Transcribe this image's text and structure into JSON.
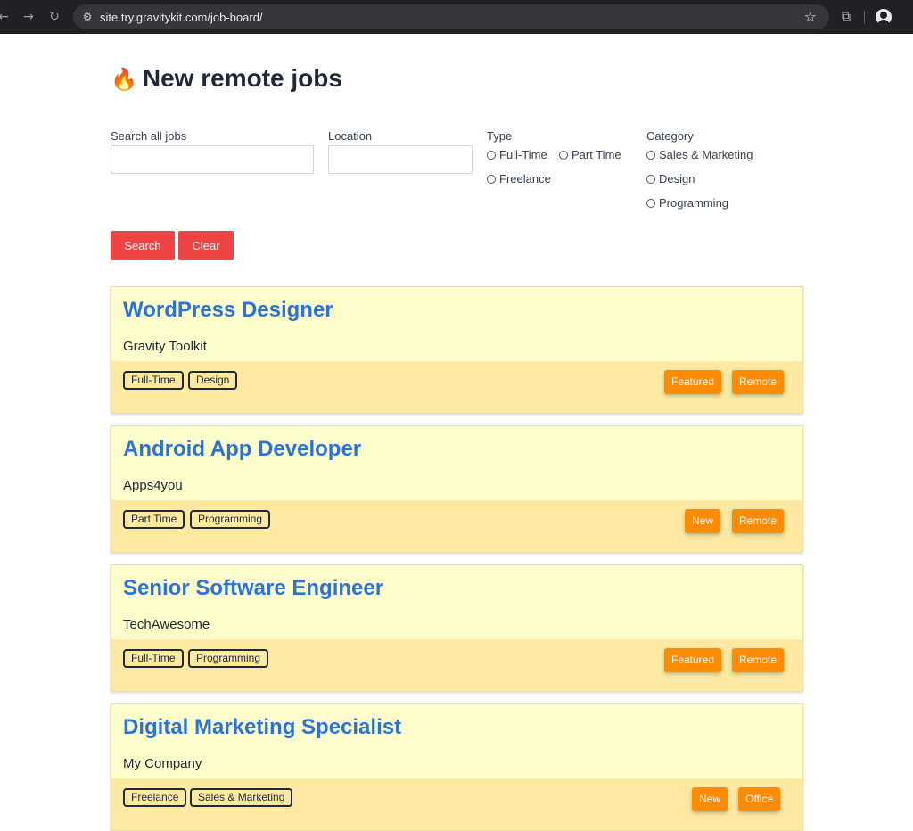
{
  "browser": {
    "url": "site.try.gravitykit.com/job-board/"
  },
  "page": {
    "title": "New remote jobs",
    "title_icon": "fire-icon"
  },
  "filters": {
    "search_label": "Search all jobs",
    "search_value": "",
    "location_label": "Location",
    "location_value": "",
    "type_label": "Type",
    "type_options": [
      "Full-Time",
      "Part Time",
      "Freelance"
    ],
    "category_label": "Category",
    "category_options": [
      "Sales & Marketing",
      "Design",
      "Programming"
    ],
    "search_button": "Search",
    "clear_button": "Clear"
  },
  "jobs": [
    {
      "title": "WordPress Designer",
      "company": "Gravity Toolkit",
      "tags": [
        "Full-Time",
        "Design"
      ],
      "badges": [
        "Featured",
        "Remote"
      ]
    },
    {
      "title": "Android App Developer",
      "company": "Apps4you",
      "tags": [
        "Part Time",
        "Programming"
      ],
      "badges": [
        "New",
        "Remote"
      ]
    },
    {
      "title": "Senior Software Engineer",
      "company": "TechAwesome",
      "tags": [
        "Full-Time",
        "Programming"
      ],
      "badges": [
        "Featured",
        "Remote"
      ]
    },
    {
      "title": "Digital Marketing Specialist",
      "company": "My Company",
      "tags": [
        "Freelance",
        "Sales & Marketing"
      ],
      "badges": [
        "New",
        "Office"
      ]
    }
  ],
  "colors": {
    "accent_button": "#ef4444",
    "job_title": "#2b73d9",
    "card_bg": "#fefecd",
    "card_footer_bg": "#fde9a1",
    "badge_bg": "#ff8c00"
  }
}
